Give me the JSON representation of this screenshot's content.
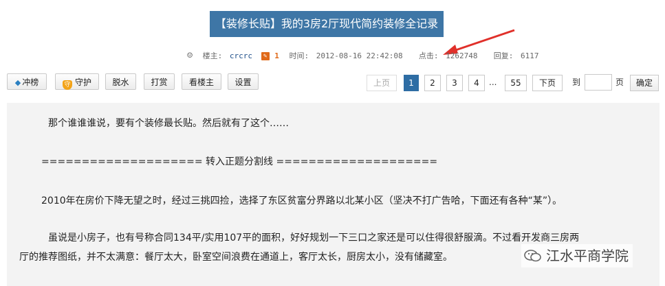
{
  "thread": {
    "title": "【装修长贴】我的3房2厅现代简约装修全记录",
    "author_label": "楼主:",
    "author": "crcrc",
    "level": "1",
    "time_label": "时间:",
    "time": "2012-08-16 22:42:08",
    "views_label": "点击:",
    "views": "1262748",
    "replies_label": "回复:",
    "replies": "6117"
  },
  "toolbar": {
    "rank_label": "冲榜",
    "guard_label": "守护",
    "dehydrate_label": "脱水",
    "reward_label": "打赏",
    "owner_only_label": "看楼主",
    "settings_label": "设置"
  },
  "pagination": {
    "prev_label": "上页",
    "pages": [
      "1",
      "2",
      "3",
      "4"
    ],
    "ellipsis": "...",
    "last_page": "55",
    "next_label": "下页",
    "goto_label": "到",
    "page_unit": "页",
    "confirm_label": "确定",
    "current_page": 1
  },
  "post": {
    "p1": "那个谁谁谁说，要有个装修最长贴。然后就有了这个……",
    "p2": "==================== 转入正题分割线 ====================",
    "p3": "2010年在房价下降无望之时，经过三挑四捡，选择了东区贫富分界路以北某小区（坚决不打广告哈，下面还有各种“某”）。",
    "p4a": "虽说是小房子，也有号称合同134平/实用107平的面积，好好规划一下三口之家还是可以住得很舒服滴。不过看开发商三房两",
    "p4b": "厅的推荐图纸，并不太满意：餐厅太大，卧室空间浪费在通道上，客厅太长，厨房太小，没有储藏室。"
  },
  "watermark": {
    "text": "江水平商学院"
  },
  "colors": {
    "title_bg": "#3e76a6",
    "active_page": "#2e6da4",
    "arrow": "#e0302a",
    "post_bg": "#f3f3f3"
  }
}
